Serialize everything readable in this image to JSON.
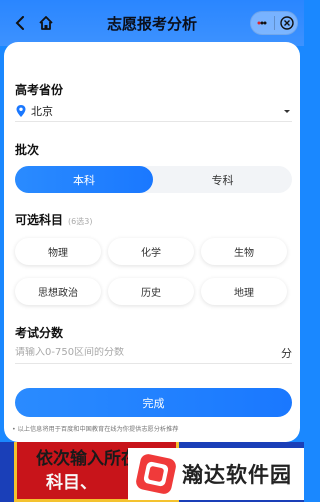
{
  "header": {
    "title": "志愿报考分析"
  },
  "form": {
    "province_label": "高考省份",
    "province_value": "北京",
    "batch_label": "批次",
    "batch_options": [
      "本科",
      "专科"
    ],
    "batch_selected": "本科",
    "subject_label": "可选科目",
    "subject_hint": "(6选3)",
    "subjects": [
      "物理",
      "化学",
      "生物",
      "思想政治",
      "历史",
      "地理"
    ],
    "score_label": "考试分数",
    "score_placeholder": "请输入0-750区间的分数",
    "score_unit": "分",
    "submit_label": "完成",
    "disclaimer": "• 以上信息将用于百度和中国教育在线为你提供志愿分析推荐"
  },
  "banner": {
    "line1": "依次输入所在省份、批次",
    "line2": "科目、"
  },
  "watermark": {
    "text": "瀚达软件园"
  },
  "colors": {
    "primary": "#1a78ff",
    "banner_red": "#c8141a",
    "banner_blue": "#1a3fb8"
  }
}
